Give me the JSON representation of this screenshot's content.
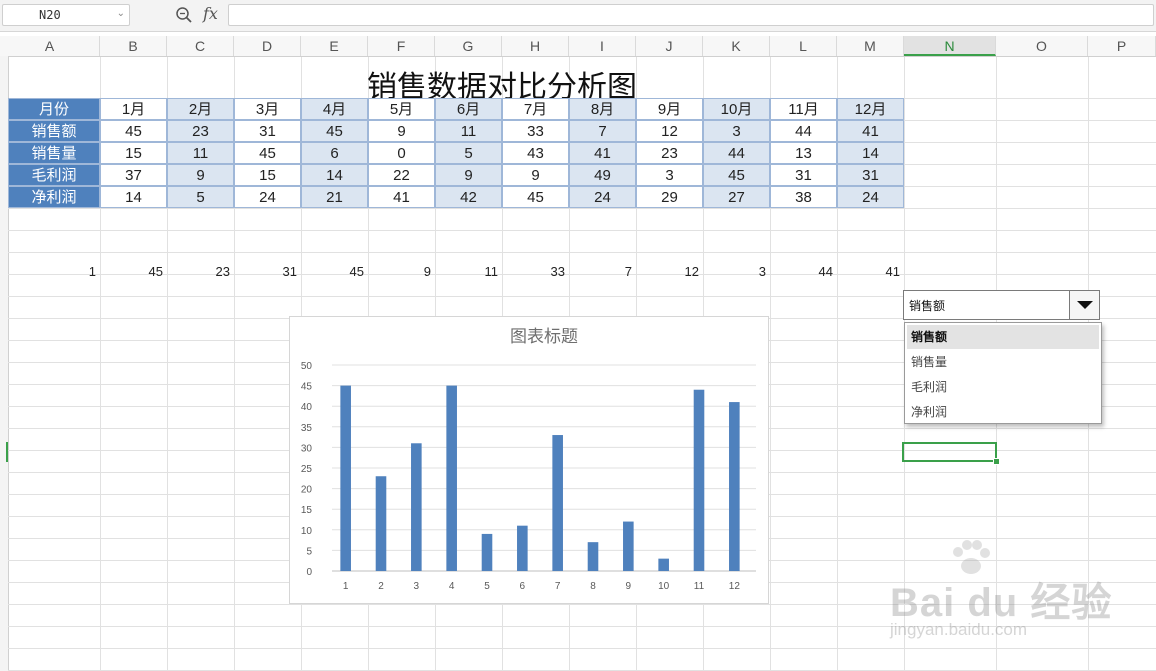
{
  "formula_bar": {
    "cell_ref": "N20",
    "fx_label": "fx"
  },
  "columns": [
    "A",
    "B",
    "C",
    "D",
    "E",
    "F",
    "G",
    "H",
    "I",
    "J",
    "K",
    "L",
    "M",
    "N",
    "O",
    "P"
  ],
  "selected_column": "N",
  "sheet_title": "销售数据对比分析图",
  "table": {
    "header_label": "月份",
    "months": [
      "1月",
      "2月",
      "3月",
      "4月",
      "5月",
      "6月",
      "7月",
      "8月",
      "9月",
      "10月",
      "11月",
      "12月"
    ],
    "rows": [
      {
        "label": "销售额",
        "values": [
          45,
          23,
          31,
          45,
          9,
          11,
          33,
          7,
          12,
          3,
          44,
          41
        ]
      },
      {
        "label": "销售量",
        "values": [
          15,
          11,
          45,
          6,
          0,
          5,
          43,
          41,
          23,
          44,
          13,
          14
        ]
      },
      {
        "label": "毛利润",
        "values": [
          37,
          9,
          15,
          14,
          22,
          9,
          9,
          49,
          3,
          45,
          31,
          31
        ]
      },
      {
        "label": "净利润",
        "values": [
          14,
          5,
          24,
          21,
          41,
          42,
          45,
          24,
          29,
          27,
          38,
          24
        ]
      }
    ]
  },
  "helper_row": {
    "index": 1,
    "values": [
      45,
      23,
      31,
      45,
      9,
      11,
      33,
      7,
      12,
      3,
      44,
      41
    ]
  },
  "dropdown": {
    "selected": "销售额",
    "options": [
      "销售额",
      "销售量",
      "毛利润",
      "净利润"
    ]
  },
  "chart_data": {
    "type": "bar",
    "title": "图表标题",
    "categories": [
      "1",
      "2",
      "3",
      "4",
      "5",
      "6",
      "7",
      "8",
      "9",
      "10",
      "11",
      "12"
    ],
    "values": [
      45,
      23,
      31,
      45,
      9,
      11,
      33,
      7,
      12,
      3,
      44,
      41
    ],
    "ylim": [
      0,
      50
    ],
    "yticks": [
      0,
      5,
      10,
      15,
      20,
      25,
      30,
      35,
      40,
      45,
      50
    ],
    "grid": true,
    "bar_color": "#4f81bd"
  },
  "colors": {
    "header_blue": "#4f81bd",
    "alt_fill": "#dbe5f1",
    "selection_green": "#3aa04a"
  },
  "watermark": {
    "logo_text": "Bai du 经验",
    "sub_text": "jingyan.baidu.com"
  }
}
